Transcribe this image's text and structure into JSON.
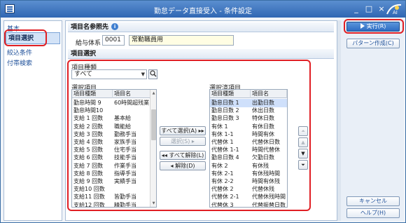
{
  "window": {
    "title": "勤怠データ直接受入 - 条件設定",
    "controls": [
      "_",
      "□",
      "×"
    ]
  },
  "nav": {
    "items": [
      {
        "label": "基本",
        "active": false
      },
      {
        "label": "項目選択",
        "active": true
      },
      {
        "label": "絞込条件",
        "active": false
      },
      {
        "label": "付帯検索",
        "active": false
      }
    ]
  },
  "reference": {
    "heading": "項目名参照先",
    "system_label": "給与体系",
    "code": "0001",
    "name": "常勤職員用"
  },
  "selection": {
    "heading": "項目選択",
    "type_label": "項目種類",
    "type_value": "すべて",
    "left_label": "選択項目",
    "right_label": "選択済項目",
    "col_type": "項目種類",
    "col_name": "項目名",
    "left_rows": [
      {
        "type": "勤怠時間 9",
        "name": "60時間超残業"
      },
      {
        "type": "勤怠時間10",
        "name": ""
      },
      {
        "type": "支給 1 回数",
        "name": "基本給"
      },
      {
        "type": "支給 2 回数",
        "name": "職能給"
      },
      {
        "type": "支給 3 回数",
        "name": "勤務手当"
      },
      {
        "type": "支給 4 回数",
        "name": "家族手当"
      },
      {
        "type": "支給 5 回数",
        "name": "住宅手当"
      },
      {
        "type": "支給 6 回数",
        "name": "技能手当"
      },
      {
        "type": "支給 7 回数",
        "name": "作業手当"
      },
      {
        "type": "支給 8 回数",
        "name": "指導手当"
      },
      {
        "type": "支給 9 回数",
        "name": "実績手当"
      },
      {
        "type": "支給10 回数",
        "name": ""
      },
      {
        "type": "支給11 回数",
        "name": "皆勤手当"
      },
      {
        "type": "支給12 回数",
        "name": "精勤手当"
      }
    ],
    "right_rows": [
      {
        "type": "勤怠日数 1",
        "name": "出勤日数",
        "selected": true
      },
      {
        "type": "勤怠日数 2",
        "name": "休出日数",
        "selected": false
      },
      {
        "type": "勤怠日数 3",
        "name": "特休日数",
        "selected": false
      },
      {
        "type": "有休 1",
        "name": "有休日数",
        "selected": false
      },
      {
        "type": "有休 1-1",
        "name": "時間有休",
        "selected": false
      },
      {
        "type": "代替休 1",
        "name": "代替休日数",
        "selected": false
      },
      {
        "type": "代替休 1-1",
        "name": "時間代替休",
        "selected": false
      },
      {
        "type": "勤怠日数 4",
        "name": "欠勤日数",
        "selected": false
      },
      {
        "type": "有休 2",
        "name": "有休残",
        "selected": false
      },
      {
        "type": "有休 2-1",
        "name": "有休残時間",
        "selected": false
      },
      {
        "type": "有休 2-2",
        "name": "時間有休残",
        "selected": false
      },
      {
        "type": "代替休 2",
        "name": "代替休残",
        "selected": false
      },
      {
        "type": "代替休 2-1",
        "name": "代替休残時間",
        "selected": false
      },
      {
        "type": "代替休 3",
        "name": "代替振替日数",
        "selected": false
      }
    ],
    "btn_select_all": "すべて選択(A)",
    "btn_select": "選択(S)",
    "btn_release_all": "すべて解除(L)",
    "btn_release": "解除(D)"
  },
  "side": {
    "execute": "実行(R)",
    "pattern": "パターン作成(C)",
    "cancel": "キャンセル",
    "help": "ヘルプ(H)"
  },
  "colors": {
    "title_bar": "#2f66b3",
    "highlight": "#e01f24",
    "selected_row": "#cfe0fb",
    "primary_button": "#2d6cc2"
  }
}
